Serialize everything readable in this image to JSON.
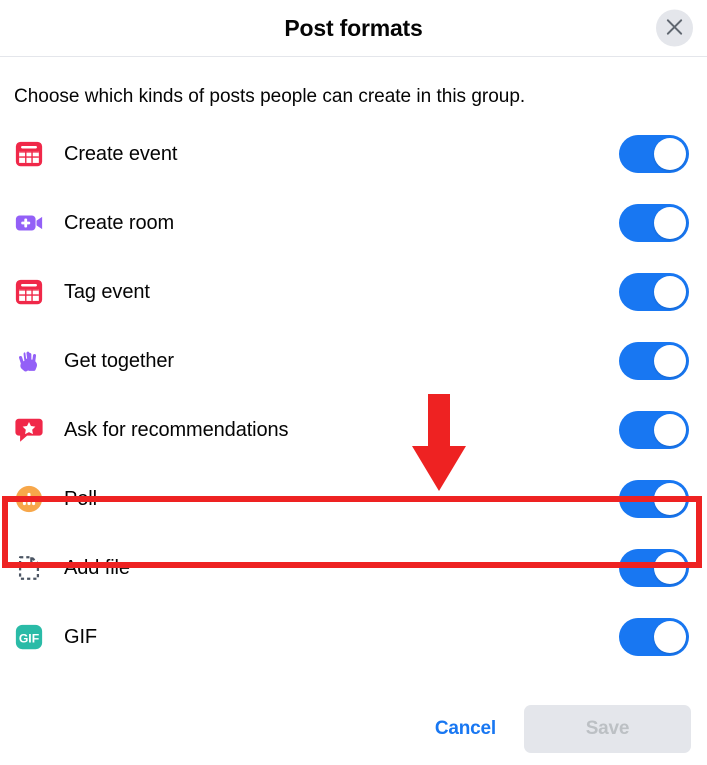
{
  "dialog": {
    "title": "Post formats",
    "close_icon": "close-icon",
    "subtitle": "Choose which kinds of posts people can create in this group.",
    "formats": [
      {
        "label": "Create event",
        "icon": "calendar-icon",
        "toggle": "on"
      },
      {
        "label": "Create room",
        "icon": "video-camera-plus-icon",
        "toggle": "on"
      },
      {
        "label": "Tag event",
        "icon": "calendar-icon",
        "toggle": "on"
      },
      {
        "label": "Get together",
        "icon": "raised-hands-icon",
        "toggle": "on"
      },
      {
        "label": "Ask for recommendations",
        "icon": "speech-bubble-star-icon",
        "toggle": "on"
      },
      {
        "label": "Poll",
        "icon": "poll-bar-chart-icon",
        "toggle": "on"
      },
      {
        "label": "Add file",
        "icon": "document-dashed-icon",
        "toggle": "on"
      },
      {
        "label": "GIF",
        "icon": "gif-icon",
        "toggle": "on"
      }
    ],
    "footer": {
      "cancel_label": "Cancel",
      "save_label": "Save"
    }
  },
  "annotation": {
    "highlight_color": "#ee2222",
    "arrow_color": "#ee2222",
    "highlighted_row": "Poll"
  },
  "colors": {
    "toggle_on": "#1877f2",
    "link": "#1877f2",
    "calendar": "#f02849",
    "room": "#9360f7",
    "hands": "#9360f7",
    "recommendations": "#f02849",
    "poll": "#f7a74a",
    "file": "#4b5563",
    "gif": "#2abba7"
  }
}
